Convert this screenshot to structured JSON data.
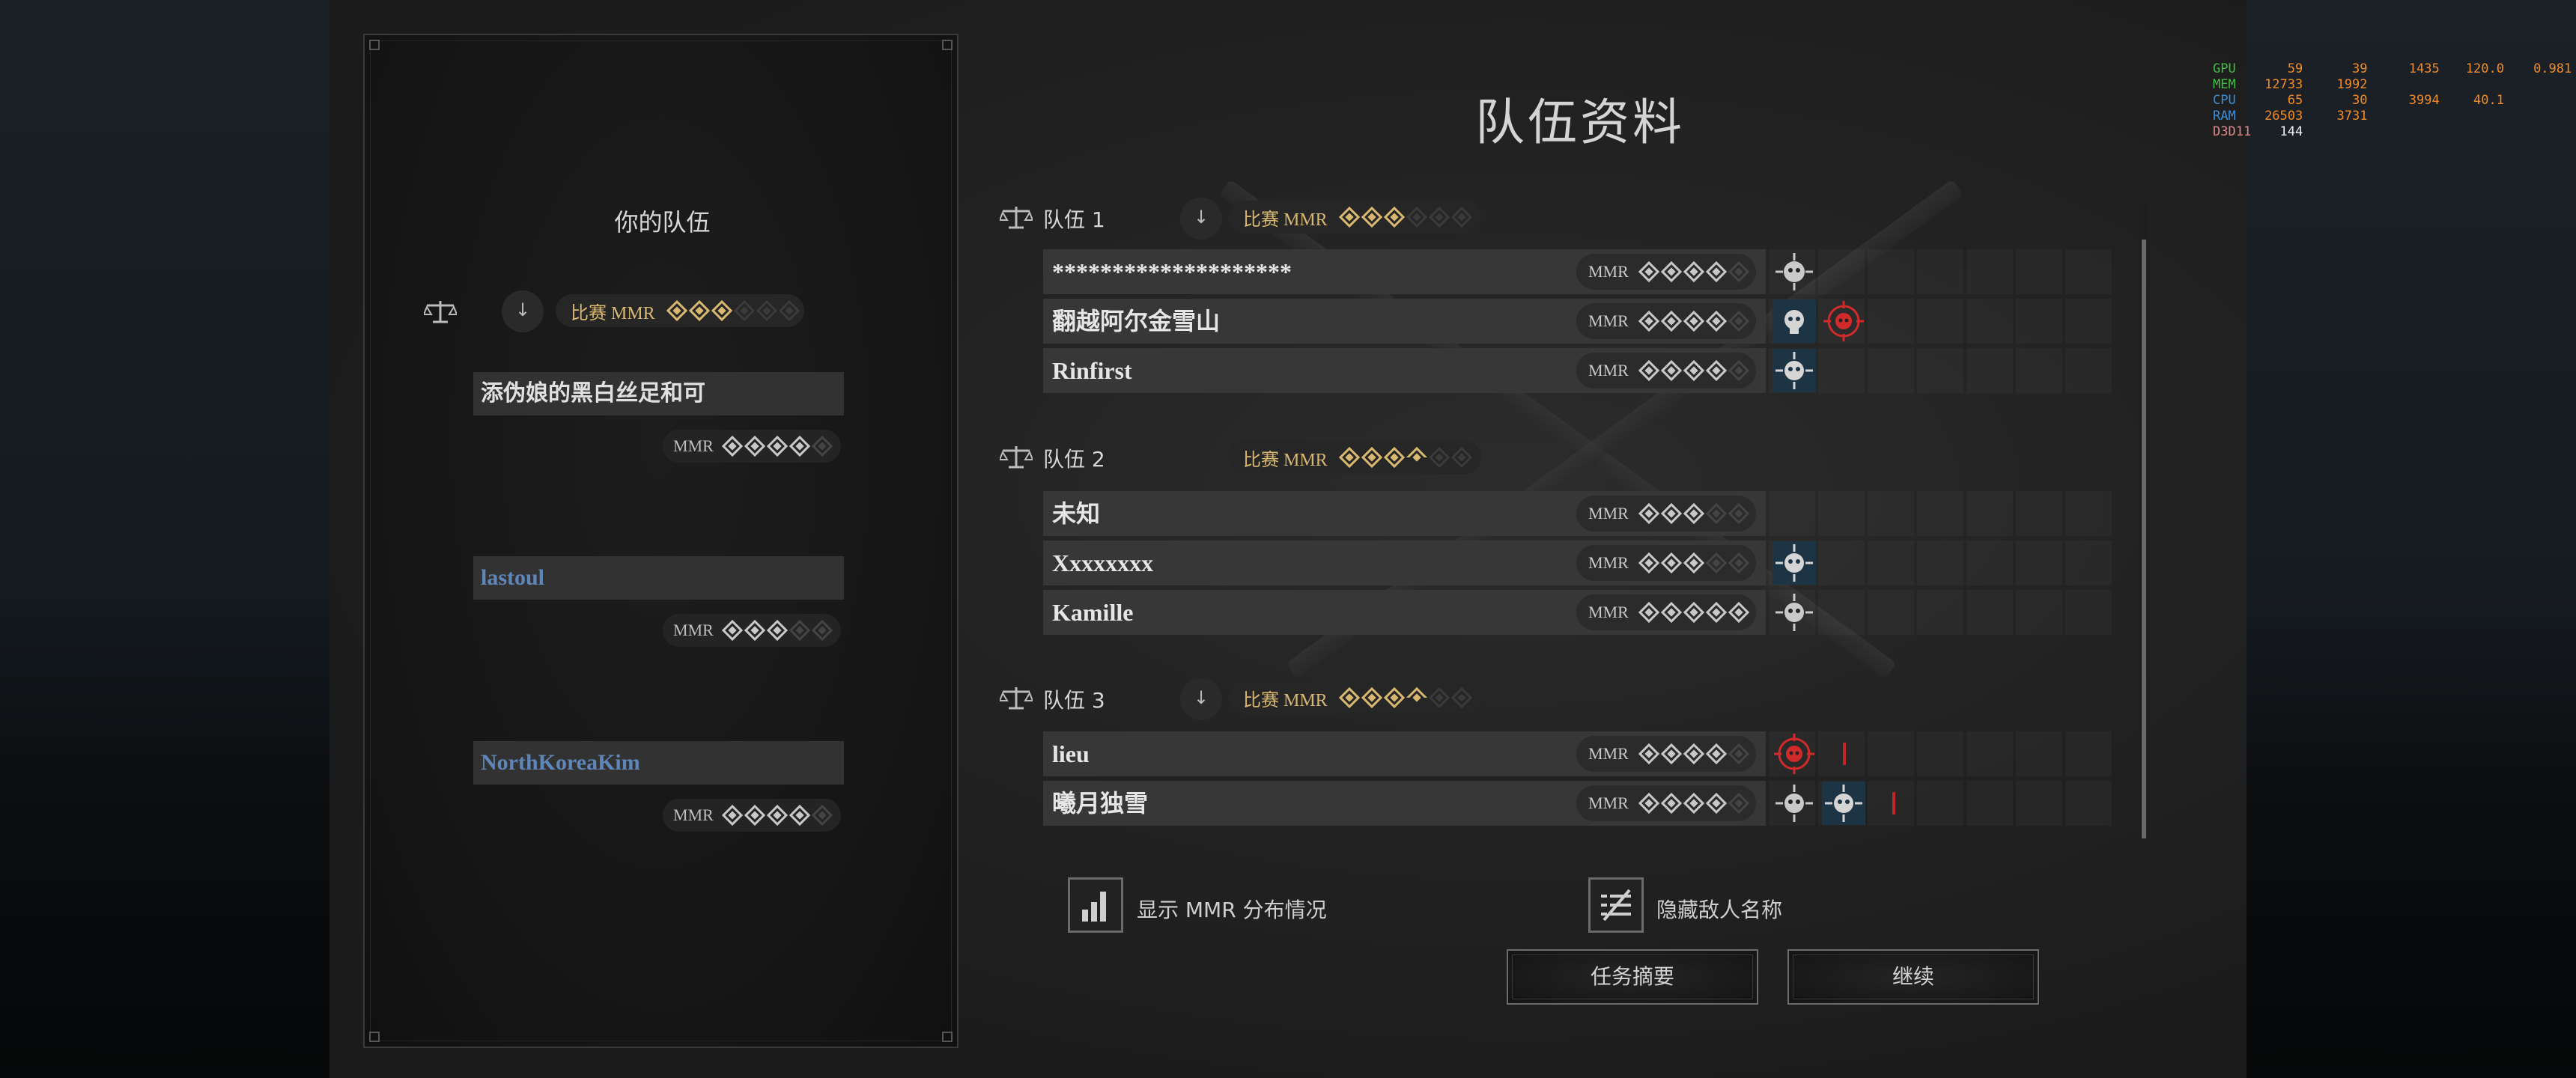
{
  "page_title": "队伍资料",
  "your_team": {
    "title": "你的队伍",
    "mmr_label": "比赛 MMR",
    "mmr_stars": 3,
    "members": [
      {
        "name": "添伪娘的黑白丝足和可",
        "mmr_label": "MMR",
        "stars": 4,
        "color": "#e0e0e0"
      },
      {
        "name": "lastoul",
        "mmr_label": "MMR",
        "stars": 3,
        "color": "#5e86b8"
      },
      {
        "name": "NorthKoreaKim",
        "mmr_label": "MMR",
        "stars": 4,
        "color": "#5e86b8"
      }
    ]
  },
  "teams": [
    {
      "label": "队伍 1",
      "mmr_label": "比赛 MMR",
      "mmr_stars": "3 of 6",
      "players": [
        {
          "name": "********************",
          "mmr_label": "MMR",
          "stars": 4
        },
        {
          "name": "翻越阿尔金雪山",
          "mmr_label": "MMR",
          "stars": 4
        },
        {
          "name": "Rinfirst",
          "mmr_label": "MMR",
          "stars": 4
        }
      ]
    },
    {
      "label": "队伍 2",
      "mmr_label": "比赛 MMR",
      "mmr_stars": "3.5 of 6",
      "players": [
        {
          "name": "未知",
          "mmr_label": "MMR",
          "stars": 3
        },
        {
          "name": "Xxxxxxxx",
          "mmr_label": "MMR",
          "stars": 3
        },
        {
          "name": "Kamille",
          "mmr_label": "MMR",
          "stars": 5
        }
      ]
    },
    {
      "label": "队伍 3",
      "mmr_label": "比赛 MMR",
      "mmr_stars": "3.5 of 6",
      "players": [
        {
          "name": "lieu",
          "mmr_label": "MMR",
          "stars": 4
        },
        {
          "name": "曦月独雪",
          "mmr_label": "MMR",
          "stars": 4
        }
      ]
    }
  ],
  "toggles": {
    "show_mmr_distribution": "显示 MMR 分布情况",
    "hide_enemy_names": "隐藏敌人名称"
  },
  "buttons": {
    "mission_summary": "任务摘要",
    "continue": "继续"
  },
  "perf_overlay": {
    "gpu": {
      "label": "GPU",
      "temp": "59",
      "load": "39",
      "clock": "1435",
      "power": "120.0",
      "volt": "0.981"
    },
    "mem": {
      "label": "MEM",
      "used": "12733",
      "clock": "1992"
    },
    "cpu": {
      "label": "CPU",
      "temp": "65",
      "load": "30",
      "clock": "3994",
      "power": "40.1"
    },
    "ram": {
      "label": "RAM",
      "used": "26503",
      "extra": "3731"
    },
    "api": {
      "label": "D3D11",
      "fps": "144"
    }
  },
  "colors": {
    "gold_accent": "#d8b870",
    "bounty_blue": "#1d3445",
    "bounty_red": "#d22a2a",
    "perf_orange": "#f08b2a",
    "perf_green": "#3fbf3f",
    "perf_blue": "#3a8fd8"
  }
}
